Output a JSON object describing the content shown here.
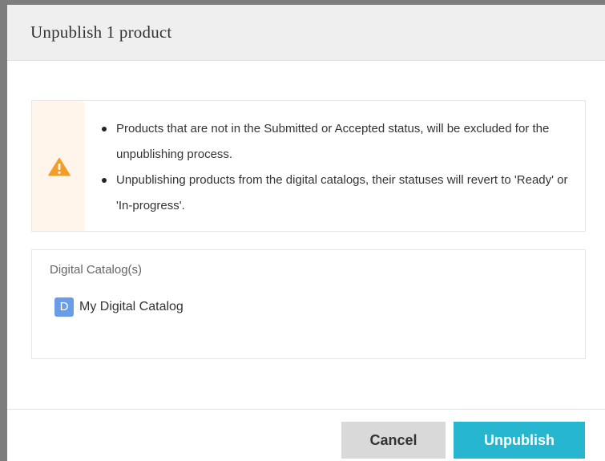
{
  "dialog": {
    "title": "Unpublish 1 product"
  },
  "warning": {
    "icon": "warning-triangle-icon",
    "icon_color": "#f39c28",
    "items": [
      "Products that are not in the Submitted or Accepted status, will be excluded for the unpublishing process.",
      "Unpublishing products from the digital catalogs, their statuses will revert to 'Ready' or 'In-progress'."
    ]
  },
  "catalogs": {
    "label": "Digital Catalog(s)",
    "items": [
      {
        "badge": "D",
        "name": "My Digital Catalog"
      }
    ]
  },
  "footer": {
    "cancel_label": "Cancel",
    "unpublish_label": "Unpublish",
    "unpublish_color": "#26b6cf"
  }
}
